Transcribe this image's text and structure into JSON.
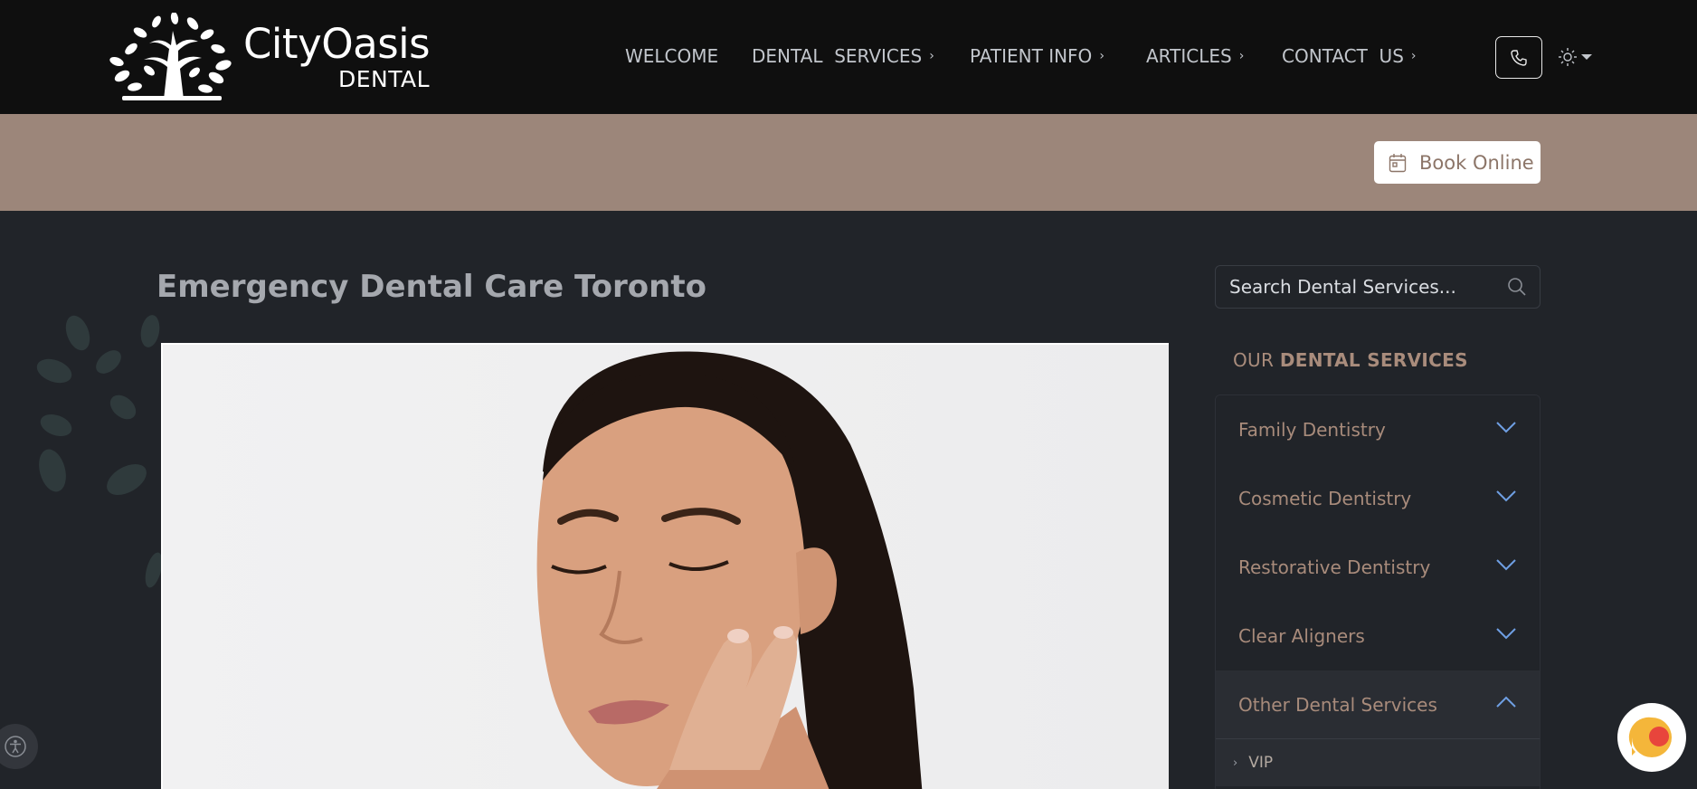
{
  "brand": {
    "name": "CityOasis",
    "sub": "DENTAL"
  },
  "nav": {
    "items": [
      {
        "label": "WELCOME"
      },
      {
        "label": "DENTAL  SERVICES"
      },
      {
        "label": "PATIENT INFO"
      },
      {
        "label": "ARTICLES"
      },
      {
        "label": "CONTACT  US"
      }
    ]
  },
  "icons": {
    "phone": "phone-icon",
    "theme": "sun-icon",
    "calendar": "calendar-icon",
    "search": "search-icon",
    "accessibility": "accessibility-icon",
    "chat": "chat-widget-icon"
  },
  "booking": {
    "label": "Book Online"
  },
  "main": {
    "title": "Emergency Dental Care Toronto"
  },
  "sidebar": {
    "search_placeholder": "Search Dental Services...",
    "heading_prefix": "OUR",
    "heading_strong": "DENTAL SERVICES",
    "categories": [
      {
        "label": "Family Dentistry",
        "open": false
      },
      {
        "label": "Cosmetic Dentistry",
        "open": false
      },
      {
        "label": "Restorative Dentistry",
        "open": false
      },
      {
        "label": "Clear Aligners",
        "open": false
      },
      {
        "label": "Other Dental Services",
        "open": true
      }
    ],
    "open_items": [
      {
        "label": "VIP"
      }
    ]
  },
  "colors": {
    "header_bg": "#0f0f0f",
    "booking_bar": "#9c867a",
    "page_bg": "#212429",
    "accent_tan": "#a88b7b",
    "chevron_blue": "#6f9fe3"
  }
}
